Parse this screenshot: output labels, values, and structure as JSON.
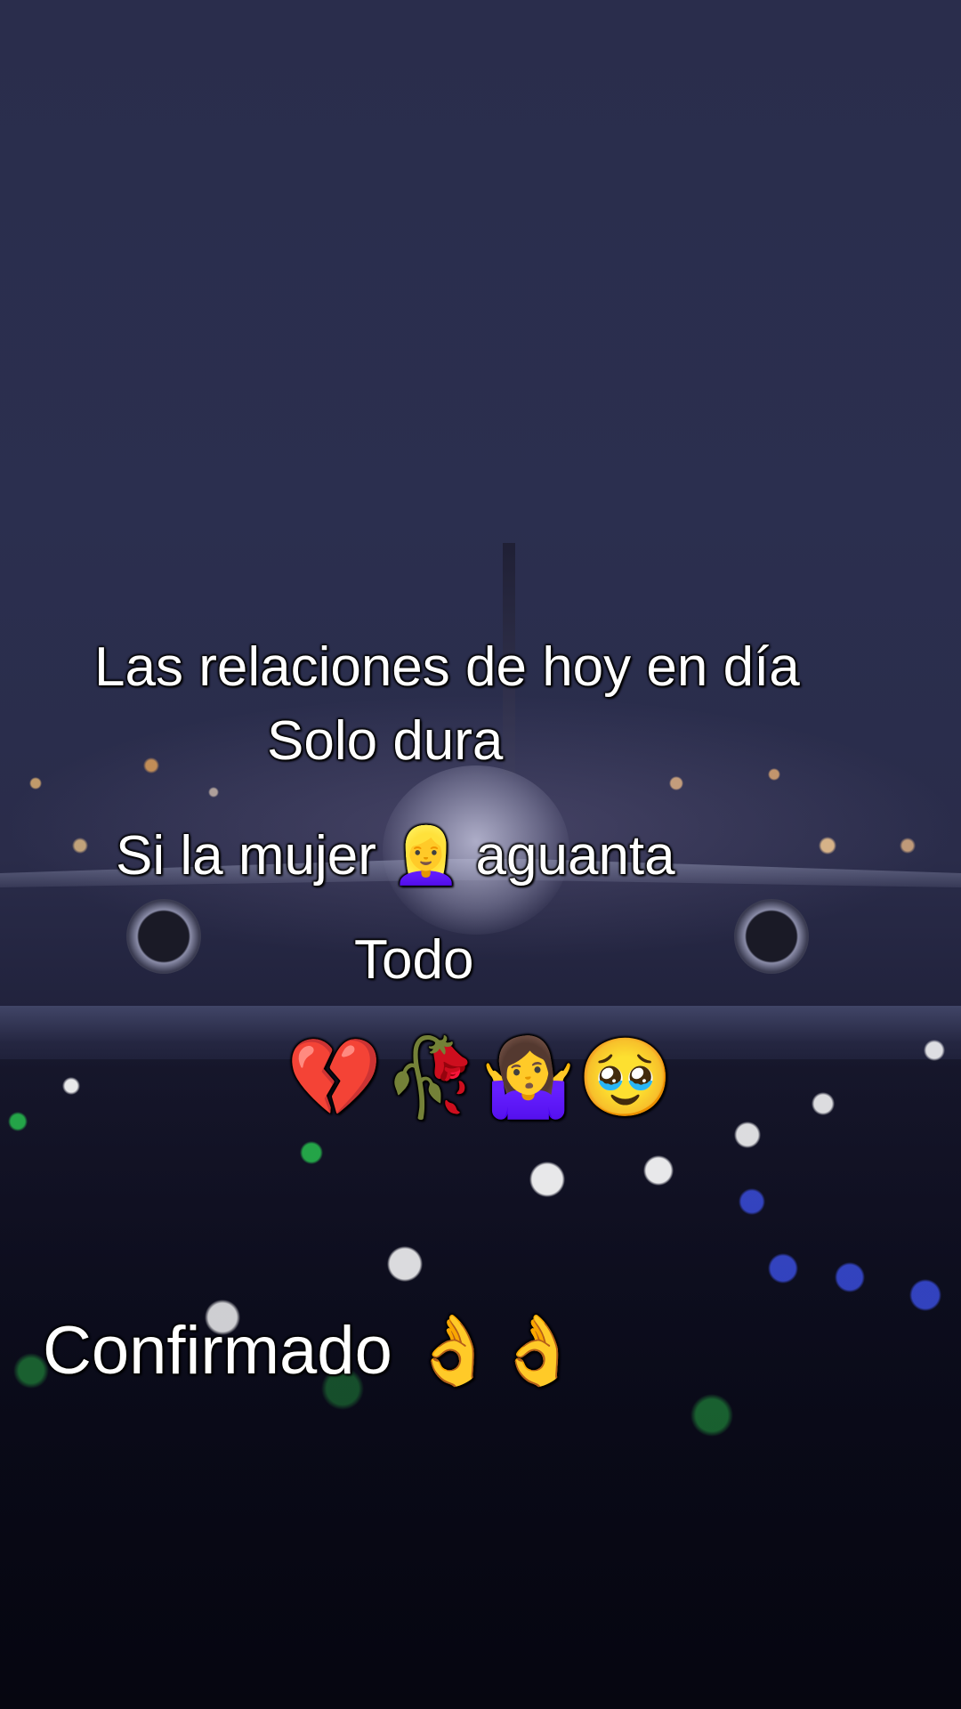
{
  "captions": {
    "line1": "Las relaciones de hoy en día",
    "line2": "Solo dura",
    "line3": "Si la mujer 👱‍♀️ aguanta",
    "line4": "Todo",
    "emoji_row": "💔🥀🤷‍♀️🥹",
    "line5": "Confirmado 👌👌"
  },
  "colors": {
    "text": "#ffffff",
    "sky": "#2a2d4c",
    "ground": "#0b0c1c"
  }
}
